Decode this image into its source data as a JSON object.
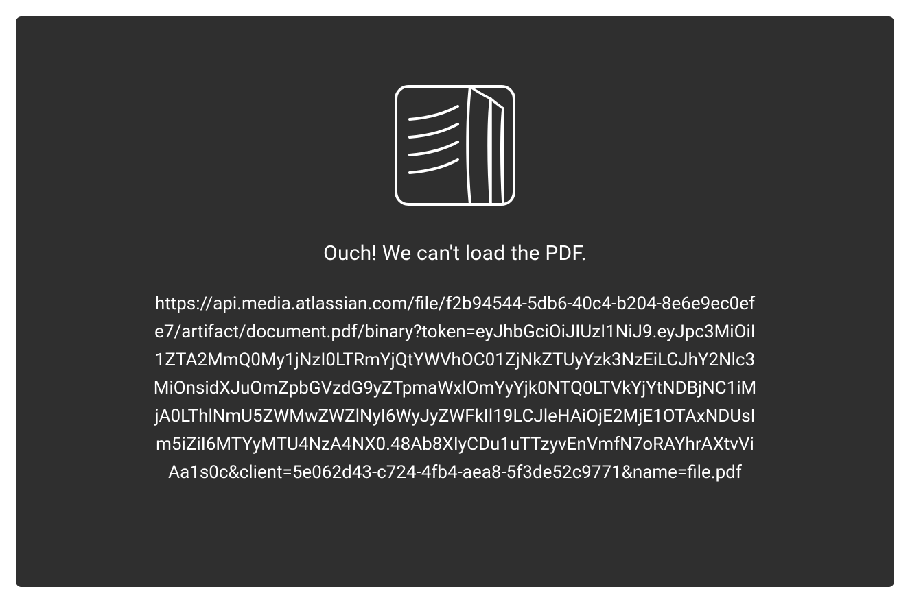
{
  "error": {
    "icon_name": "document-pages-icon",
    "title": "Ouch! We can't load the PDF.",
    "url": "https://api.media.atlassian.com/file/f2b94544-5db6-40c4-b204-8e6e9ec0efe7/artifact/document.pdf/binary?token=eyJhbGciOiJIUzI1NiJ9.eyJpc3MiOiI1ZTA2MmQ0My1jNzI0LTRmYjQtYWVhOC01ZjNkZTUyYzk3NzEiLCJhY2Nlc3MiOnsidXJuOmZpbGVzdG9yZTpmaWxlOmYyYjk0NTQ0LTVkYjYtNDBjNC1iMjA0LThlNmU5ZWMwZWZlNyI6WyJyZWFkIl19LCJleHAiOjE2MjE1OTAxNDUsIm5iZiI6MTYyMTU4NzA4NX0.48Ab8XIyCDu1uTTzyvEnVmfN7oRAYhrAXtvViAa1s0c&client=5e062d43-c724-4fb4-aea8-5f3de52c9771&name=file.pdf"
  }
}
